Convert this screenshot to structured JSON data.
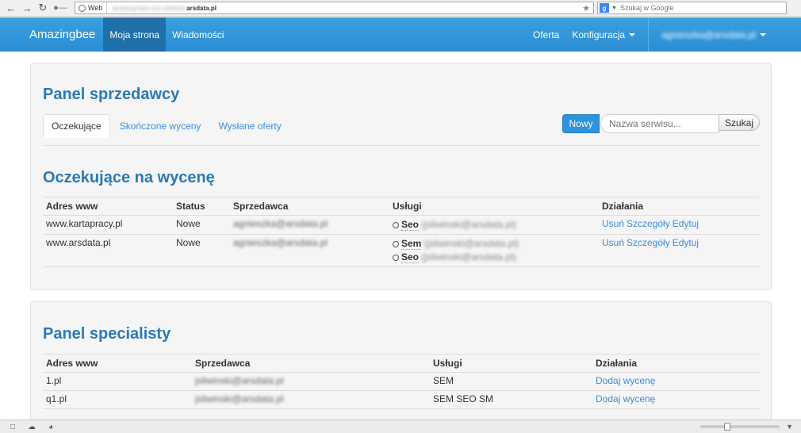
{
  "browser": {
    "web_chip": "Web",
    "url_host": "amazing-bee-crm.clients3.",
    "url_domain": "arsdata.pl",
    "search_placeholder": "Szukaj w Google"
  },
  "navbar": {
    "brand": "Amazingbee",
    "left_items": [
      "Moja strona",
      "Wiadomości"
    ],
    "right_items": [
      "Oferta",
      "Konfiguracja"
    ],
    "user": "agnieszka@arsdata.pl"
  },
  "seller_panel": {
    "title": "Panel sprzedawcy",
    "tabs": [
      "Oczekujące",
      "Skończone wyceny",
      "Wysłane oferty"
    ],
    "new_button": "Nowy",
    "search_placeholder": "Nazwa serwisu...",
    "search_button": "Szukaj",
    "section_title": "Oczekujące na wycenę",
    "columns": [
      "Adres www",
      "Status",
      "Sprzedawca",
      "Usługi",
      "Działania"
    ],
    "rows": [
      {
        "address": "www.kartapracy.pl",
        "status": "Nowe",
        "seller": "agnieszka@arsdata.pl",
        "services": [
          {
            "name": "Seo",
            "email": "(jsliwinski@arsdata.pl)"
          }
        ],
        "actions": [
          "Usuń",
          "Szczegóły",
          "Edytuj"
        ]
      },
      {
        "address": "www.arsdata.pl",
        "status": "Nowe",
        "seller": "agnieszka@arsdata.pl",
        "services": [
          {
            "name": "Sem",
            "email": "(jsliwinski@arsdata.pl)"
          },
          {
            "name": "Seo",
            "email": "(jsliwinski@arsdata.pl)"
          }
        ],
        "actions": [
          "Usuń",
          "Szczegóły",
          "Edytuj"
        ]
      }
    ]
  },
  "specialist_panel": {
    "title": "Panel specialisty",
    "columns": [
      "Adres www",
      "Sprzedawca",
      "Usługi",
      "Działania"
    ],
    "rows": [
      {
        "address": "1.pl",
        "seller": "jsliwinski@arsdata.pl",
        "services": "SEM",
        "action": "Dodaj wycenę"
      },
      {
        "address": "q1.pl",
        "seller": "jsliwinski@arsdata.pl",
        "services": "SEM SEO SM",
        "action": "Dodaj wycenę"
      }
    ]
  },
  "colors": {
    "navbar": "#2b8dd3",
    "navbar_active": "#1f6fa8",
    "heading": "#2a7ab3",
    "link": "#3a8ee0"
  }
}
